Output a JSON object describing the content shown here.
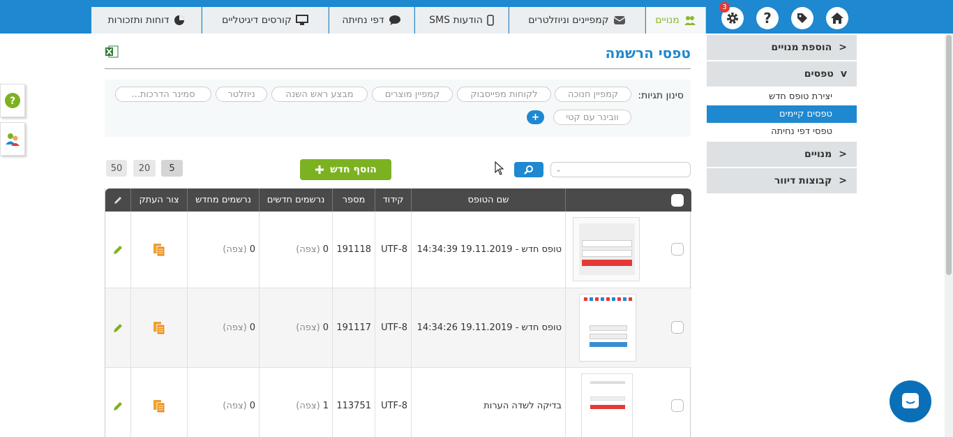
{
  "header": {
    "tabs": [
      {
        "label": "מנויים",
        "icon": "users-icon"
      },
      {
        "label": "קמפיינים וניוזלטרים",
        "icon": "envelope-icon"
      },
      {
        "label": "הודעות SMS",
        "icon": "mobile-icon"
      },
      {
        "label": "דפי נחיתה",
        "icon": "chat-icon"
      },
      {
        "label": "קורסים דיגיטליים",
        "icon": "monitor-icon"
      },
      {
        "label": "דוחות ותזכורות",
        "icon": "pie-chart-icon"
      }
    ],
    "notification_count": "3",
    "help_label": "?"
  },
  "sidebar": {
    "sections": [
      {
        "label": "הוספת מנויים",
        "chevron": ">"
      },
      {
        "label": "טפסים",
        "chevron": "v"
      },
      {
        "label": "מנויים",
        "chevron": ">"
      },
      {
        "label": "קבוצות דיוור",
        "chevron": ">"
      }
    ],
    "subitems": [
      {
        "label": "יצירת טופס חדש"
      },
      {
        "label": "טפסים קיימים"
      },
      {
        "label": "טפסי דפי נחיתה"
      }
    ]
  },
  "main": {
    "title": "טפסי הרשמה",
    "filter_label": "סינון תגיות:",
    "tags": [
      "קמפיין חנוכה",
      "לקוחות מפייסבוק",
      "קמפיין מוצרים",
      "מבצע ראש השנה",
      "ניוזלטר",
      "סמינר הדרכות...",
      "וובינר עם קטי"
    ],
    "add_tag_label": "+",
    "add_button_label": "הוסף חדש",
    "page_sizes": [
      "5",
      "20",
      "50"
    ],
    "table": {
      "headers": [
        "שם הטופס",
        "קידוד",
        "מספר",
        "נרשמים חדשים",
        "נרשמים מחדש",
        "צור העתק"
      ],
      "rows": [
        {
          "name": "טופס חדש - 19.11.2019 14:34:39",
          "encoding": "UTF-8",
          "number": "191118",
          "new_count": "0",
          "new_view": "(צפה)",
          "re_count": "0",
          "re_view": "(צפה)"
        },
        {
          "name": "טופס חדש - 19.11.2019 14:34:26",
          "encoding": "UTF-8",
          "number": "191117",
          "new_count": "0",
          "new_view": "(צפה)",
          "re_count": "0",
          "re_view": "(צפה)"
        },
        {
          "name": "בדיקה לשדה הערות",
          "encoding": "UTF-8",
          "number": "113751",
          "new_count": "1",
          "new_view": "(צפה)",
          "re_count": "0",
          "re_view": "(צפה)"
        }
      ]
    }
  },
  "colors": {
    "brand": "#1e88d0",
    "accent": "#7cb221",
    "header_dark": "#4a4a4a"
  }
}
